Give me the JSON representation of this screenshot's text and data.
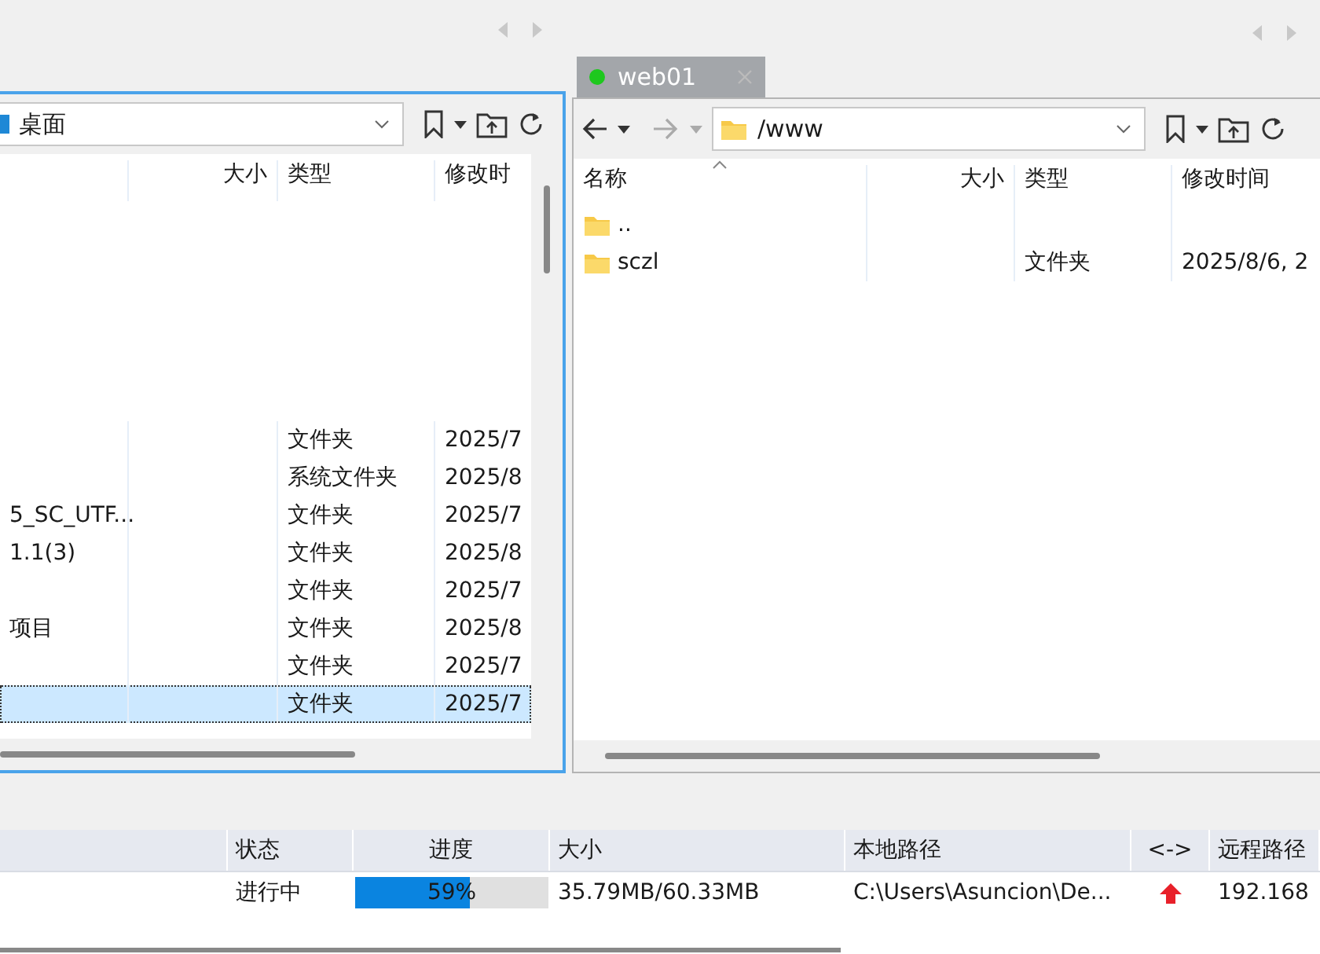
{
  "left_pane": {
    "active": true,
    "path": "桌面",
    "columns": [
      {
        "label": "大小",
        "sorted": false
      },
      {
        "label": "类型",
        "sorted": false
      },
      {
        "label": "修改时",
        "sorted": false
      }
    ],
    "rows": [
      {
        "type": "文件夹",
        "modified": "2025/7",
        "selected": false
      },
      {
        "type": "系统文件夹",
        "modified": "2025/8",
        "selected": false
      },
      {
        "name": "5_SC_UTF...",
        "type": "文件夹",
        "modified": "2025/7",
        "selected": false
      },
      {
        "name": "1.1(3)",
        "type": "文件夹",
        "modified": "2025/8",
        "selected": false
      },
      {
        "type": "文件夹",
        "modified": "2025/7",
        "selected": false
      },
      {
        "name": "项目",
        "type": "文件夹",
        "modified": "2025/8",
        "selected": false
      },
      {
        "type": "文件夹",
        "modified": "2025/7",
        "selected": false
      },
      {
        "type": "文件夹",
        "modified": "2025/7",
        "selected": true
      }
    ]
  },
  "right_pane": {
    "active": false,
    "tab": {
      "title": "web01",
      "connected": true
    },
    "path": "/www",
    "columns": [
      {
        "label": "名称",
        "sorted": true
      },
      {
        "label": "大小",
        "sorted": false
      },
      {
        "label": "类型",
        "sorted": false
      },
      {
        "label": "修改时间",
        "sorted": false
      }
    ],
    "rows": [
      {
        "name": "..",
        "selected": false
      },
      {
        "name": "sczl",
        "type": "文件夹",
        "modified": "2025/8/6, 2",
        "selected": false
      }
    ]
  },
  "transfers": {
    "columns": [
      "状态",
      "进度",
      "大小",
      "本地路径",
      "<->",
      "远程路径"
    ],
    "rows": [
      {
        "status": "进行中",
        "level": 0.59,
        "percent": "59%",
        "size": "35.79MB/60.33MB",
        "local_path": "C:\\Users\\Asuncion\\De...",
        "kind": "upload",
        "remote_path": "192.168"
      }
    ]
  }
}
